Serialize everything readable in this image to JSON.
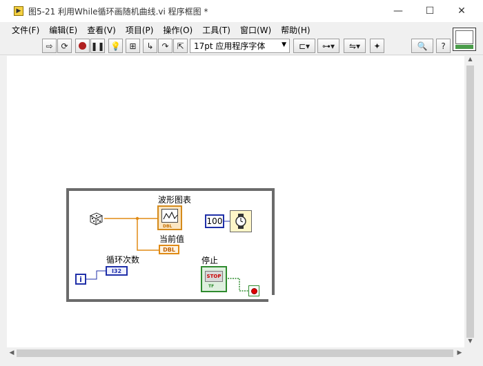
{
  "window": {
    "title": "图5-21 利用While循环画随机曲线.vi 程序框图 *",
    "minimize": "—",
    "maximize": "☐",
    "close": "✕"
  },
  "menu": [
    "文件(F)",
    "编辑(E)",
    "查看(V)",
    "项目(P)",
    "操作(O)",
    "工具(T)",
    "窗口(W)",
    "帮助(H)"
  ],
  "toolbar": {
    "font": "17pt 应用程序字体",
    "icons": [
      "run-arrow",
      "run-continuous",
      "abort",
      "pause",
      "highlight-execution",
      "retain-wire-values",
      "step-into",
      "step-over",
      "step-out",
      "align-objects",
      "distribute-objects",
      "reorder",
      "clean-up-diagram",
      "search",
      "context-help"
    ]
  },
  "diagram": {
    "chart_label": "波形图表",
    "chart_type": "DBL",
    "current_value_label": "当前值",
    "current_value_type": "DBL",
    "loop_count_label": "循环次数",
    "loop_count_type": "I32",
    "iteration_terminal": "i",
    "wait_constant": "100",
    "stop_label": "停止",
    "stop_button_text": "STOP",
    "stop_type": "TF"
  },
  "colors": {
    "double_wire": "#e08a14",
    "integer_wire": "#1f2fa8",
    "boolean_wire": "#2e8b2e",
    "loop_border": "#6b6b6b"
  }
}
